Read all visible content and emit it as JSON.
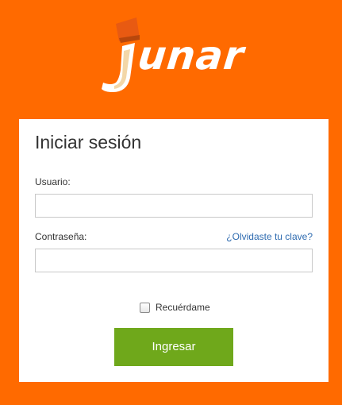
{
  "brand": {
    "logo_text": "unar",
    "colors": {
      "background": "#ff6a00",
      "primary_button": "#6fa81b",
      "link": "#2e6bb0"
    }
  },
  "login": {
    "title": "Iniciar sesión",
    "username_label": "Usuario:",
    "username_value": "",
    "password_label": "Contraseña:",
    "password_value": "",
    "forgot_link": "¿Olvidaste tu clave?",
    "remember_label": "Recuérdame",
    "remember_checked": false,
    "submit_label": "Ingresar"
  },
  "icons": {
    "logo": "junar-logo-icon",
    "checkbox": "checkbox-icon"
  }
}
